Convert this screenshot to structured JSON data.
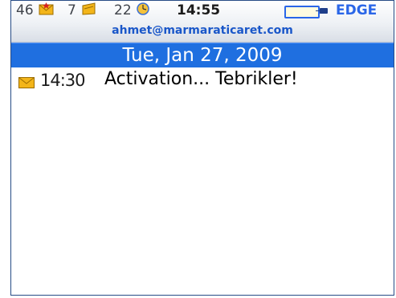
{
  "status_bar": {
    "message_count": "46",
    "pin_count": "7",
    "calendar_count": "22",
    "time": "14:55",
    "network": "EDGE",
    "account": "ahmet@marmaraticaret.com"
  },
  "inbox": {
    "date_header": "Tue, Jan 27, 2009",
    "messages": [
      {
        "time": "14:30",
        "subject": "Activation... Tebrikler!",
        "icon": "envelope-icon"
      }
    ]
  },
  "colors": {
    "header_blue": "#1f6fe0",
    "account_blue": "#1a57c9",
    "envelope": "#f3b51a"
  }
}
